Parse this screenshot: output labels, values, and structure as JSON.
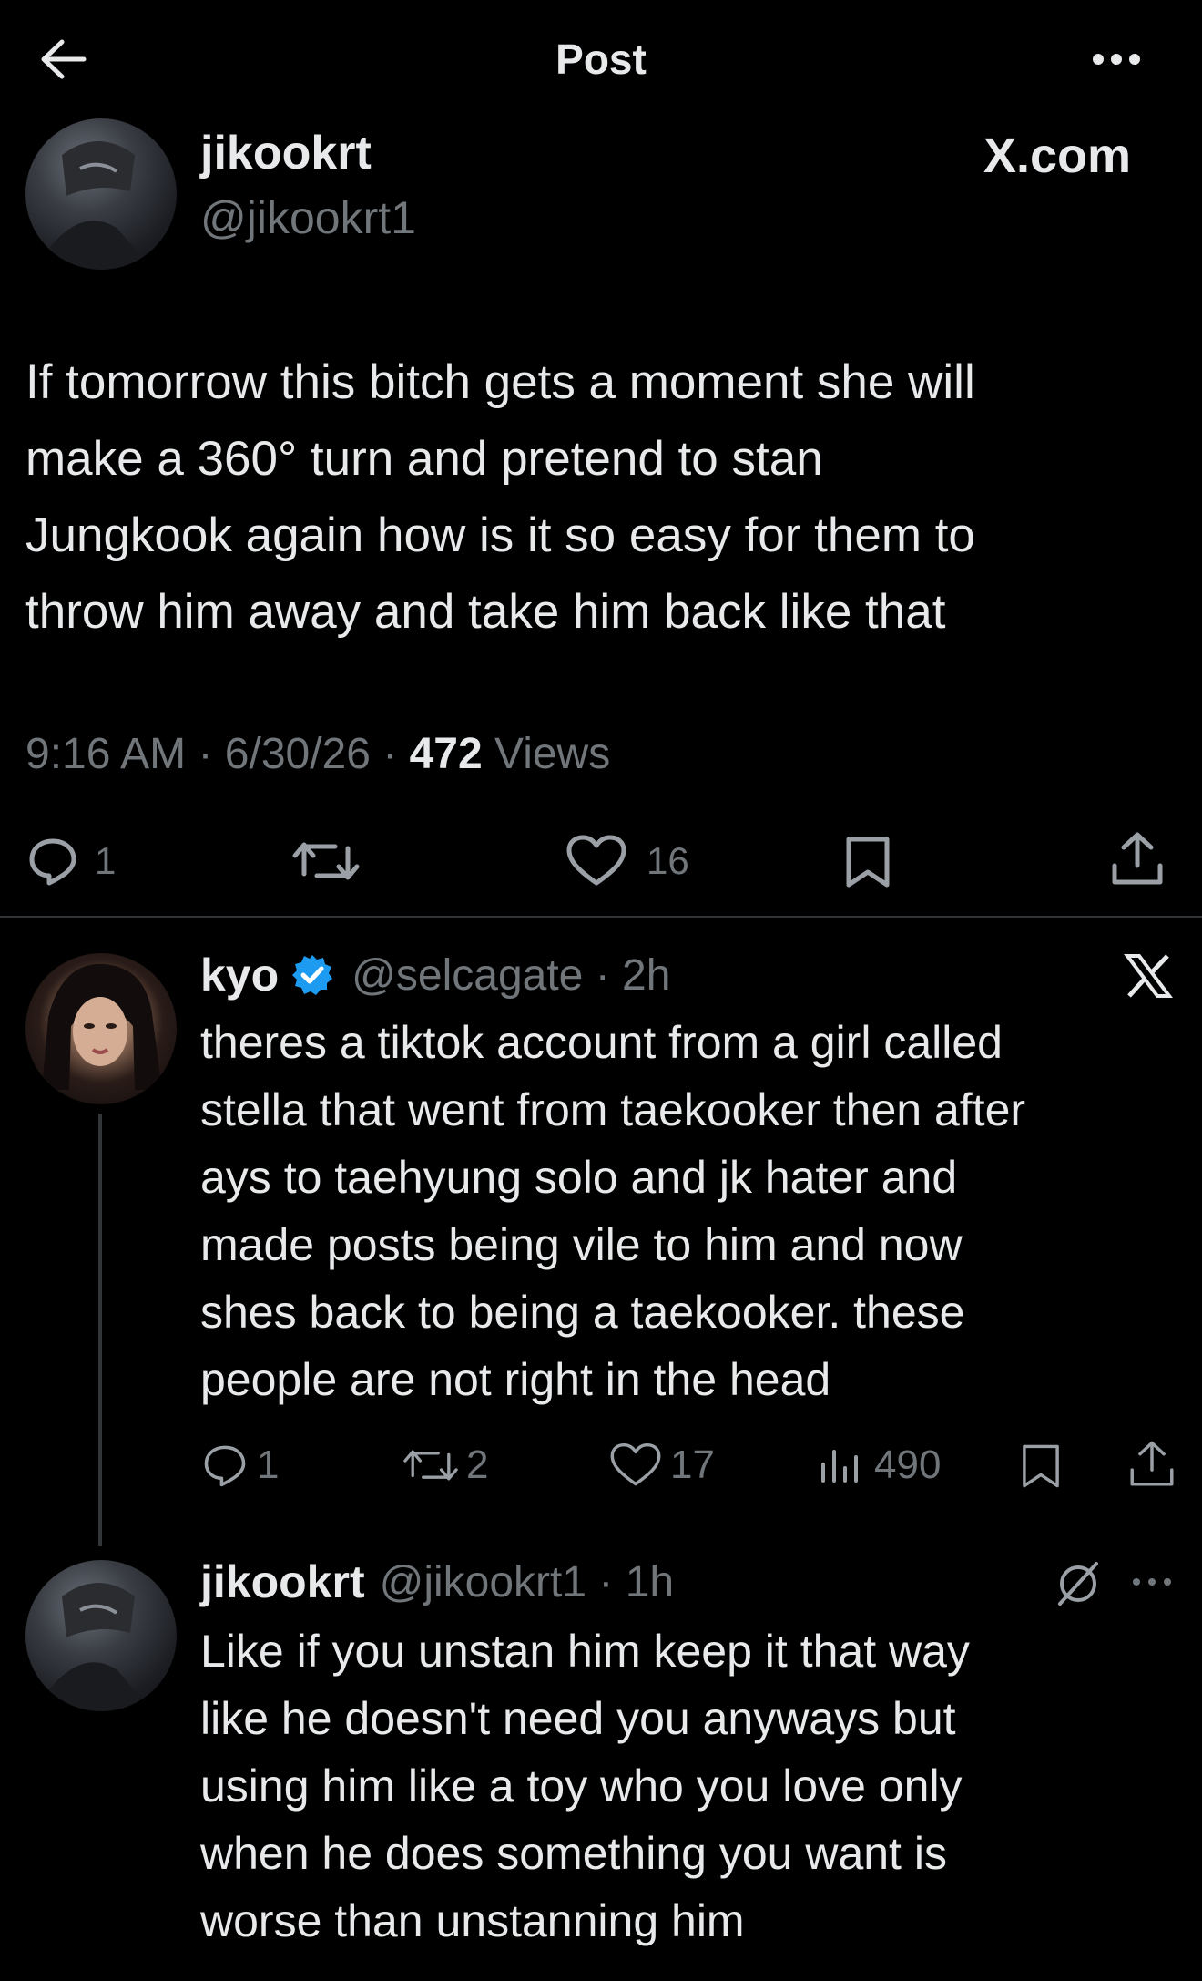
{
  "header": {
    "title": "Post"
  },
  "main_post": {
    "display_name": "jikookrt",
    "handle": "@jikookrt1",
    "watermark": "X.com",
    "text_lines": [
      "If tomorrow this bitch gets a moment she will",
      "make a 360° turn and pretend to stan",
      "Jungkook again how is it so easy for them to",
      "throw him away and take him back like that"
    ],
    "time": "9:16 AM",
    "date": "6/30/26",
    "views_count": "472",
    "views_label": "Views",
    "separator": "·",
    "replies": "1",
    "likes": "16"
  },
  "reply_1": {
    "display_name": "kyo",
    "handle_time": "@selcagate · 2h",
    "text_lines": [
      "theres a tiktok account from a girl called",
      "stella that went from taekooker then after",
      "ays to taehyung solo and jk hater and",
      "made posts being vile to him and now",
      "shes back to being a taekooker. these",
      "people are not right in the head"
    ],
    "replies": "1",
    "reposts": "2",
    "likes": "17",
    "views": "490"
  },
  "reply_2": {
    "display_name": "jikookrt",
    "handle_time": "@jikookrt1 · 1h",
    "text_lines": [
      "Like if you unstan him keep it that way",
      "like he doesn't need you anyways but",
      "using him like a toy who you love only",
      "when he does something you want is",
      "worse than unstanning him"
    ]
  },
  "colors": {
    "background": "#000000",
    "text": "#e7e9ea",
    "secondary": "#71767b",
    "verified": "#1d9bf0"
  }
}
